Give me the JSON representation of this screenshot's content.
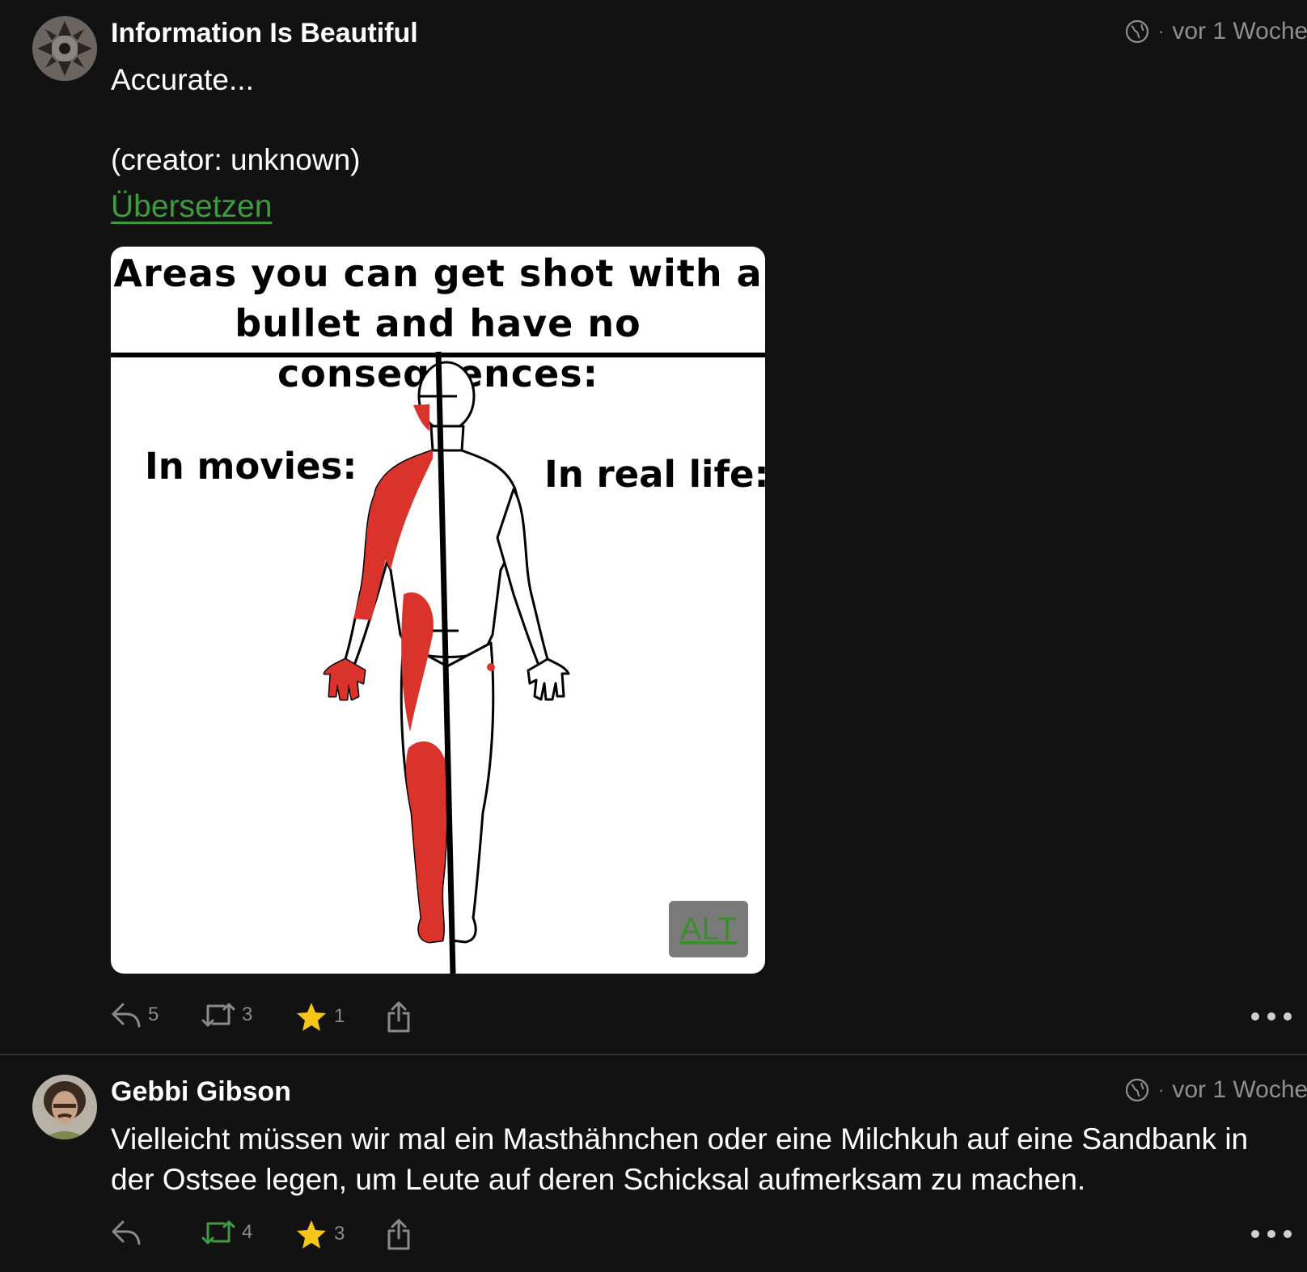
{
  "posts": [
    {
      "author": "Information Is Beautiful",
      "time": "vor 1 Woche",
      "text_line1": "Accurate...",
      "text_line2": "(creator: unknown)",
      "translate": "Übersetzen",
      "media": {
        "title_line1": "Areas you can get shot with a",
        "title_line2": "bullet and have no consequences:",
        "left_label": "In movies:",
        "right_label": "In real life:",
        "alt": "ALT"
      },
      "counts": {
        "replies": "5",
        "boosts": "3",
        "favourites": "1"
      }
    },
    {
      "author": "Gebbi Gibson",
      "time": "vor 1 Woche",
      "text_line1": "Vielleicht müssen wir mal ein Masthähnchen oder eine Milchkuh auf eine Sandbank in",
      "text_line2": "der Ostsee legen, um Leute auf deren Schicksal aufmerksam zu machen.",
      "counts": {
        "replies": "",
        "boosts": "4",
        "favourites": "3"
      }
    }
  ],
  "colors": {
    "background": "#121212",
    "link": "#3f9b3f",
    "star": "#f5c518",
    "boost_active": "#3f9b3f",
    "wound": "#d9332c"
  },
  "icons": [
    "globe-icon",
    "reply-icon",
    "boost-icon",
    "star-icon",
    "share-icon",
    "more-icon"
  ]
}
